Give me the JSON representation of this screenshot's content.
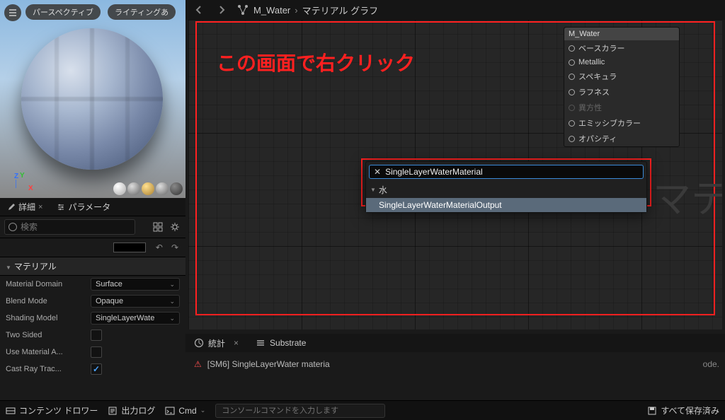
{
  "viewport": {
    "menu_icon": "menu-icon",
    "perspective": "パースペクティブ",
    "lighting": "ライティングあ"
  },
  "left_tabs": {
    "details": "詳細",
    "parameters": "パラメータ"
  },
  "search": {
    "placeholder": "検索"
  },
  "sections": {
    "material": "マテリアル"
  },
  "props": {
    "domain_label": "Material Domain",
    "domain_value": "Surface",
    "blend_label": "Blend Mode",
    "blend_value": "Opaque",
    "shading_label": "Shading Model",
    "shading_value": "SingleLayerWate",
    "twosided_label": "Two Sided",
    "usematattr_label": "Use Material A...",
    "castray_label": "Cast Ray Trac..."
  },
  "toolbar": {
    "asset": "M_Water",
    "graph": "マテリアル グラフ"
  },
  "annotation": "この画面で右クリック",
  "watermark": "マテ",
  "material_node": {
    "title": "M_Water",
    "pins": [
      {
        "label": "ベースカラー",
        "dim": false
      },
      {
        "label": "Metallic",
        "dim": false
      },
      {
        "label": "スペキュラ",
        "dim": false
      },
      {
        "label": "ラフネス",
        "dim": false
      },
      {
        "label": "異方性",
        "dim": true
      },
      {
        "label": "エミッシブカラー",
        "dim": false
      },
      {
        "label": "オパシティ",
        "dim": false
      }
    ]
  },
  "context_menu": {
    "search_value": "SingleLayerWaterMaterial",
    "category": "水",
    "item": "SingleLayerWaterMaterialOutput"
  },
  "bottom": {
    "stats_tab": "統計",
    "substrate_tab": "Substrate",
    "message": "[SM6] SingleLayerWater materia",
    "message_right": "ode."
  },
  "footer": {
    "content_drawer": "コンテンツ ドロワー",
    "output_log": "出力ログ",
    "cmd_label": "Cmd",
    "cmd_placeholder": "コンソールコマンドを入力します",
    "save_all": "すべて保存済み"
  }
}
